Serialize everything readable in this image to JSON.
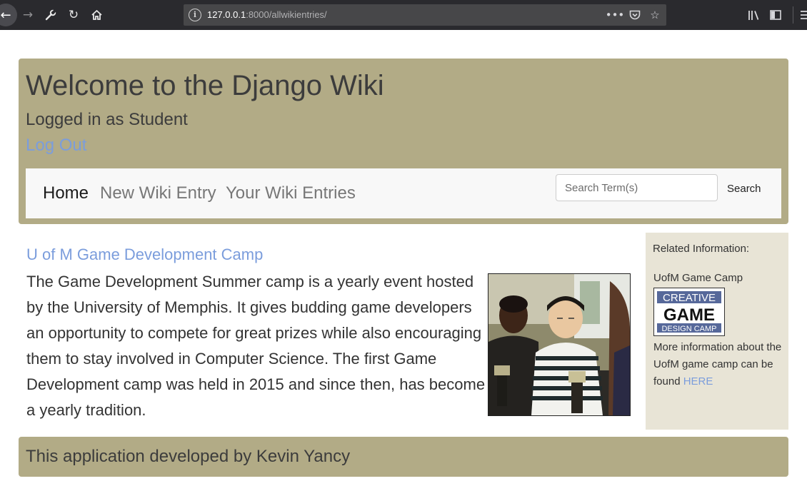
{
  "browser": {
    "url_host": "127.0.0.1",
    "url_rest": ":8000/allwikientries/",
    "icons": {
      "back": "back-arrow-icon",
      "forward": "forward-arrow-icon",
      "tools": "wrench-icon",
      "reload": "reload-icon",
      "home": "home-icon",
      "info": "info-icon",
      "page_actions": "more-dots-icon",
      "pocket": "pocket-icon",
      "bookmark": "star-icon",
      "library": "library-icon",
      "sidebar": "sidebar-icon",
      "menu": "hamburger-menu-icon"
    }
  },
  "header": {
    "title": "Welcome to the Django Wiki",
    "logged_in": "Logged in as Student",
    "logout_label": "Log Out"
  },
  "nav": {
    "items": [
      {
        "label": "Home",
        "active": true
      },
      {
        "label": "New Wiki Entry",
        "active": false
      },
      {
        "label": "Your Wiki Entries",
        "active": false
      }
    ],
    "search_placeholder": "Search Term(s)",
    "search_value": "",
    "search_button": "Search"
  },
  "entry": {
    "title": "U of M Game Development Camp",
    "body": "The Game Development Summer camp is a yearly event hosted by the University of Memphis. It gives budding game developers an opportunity to compete for great prizes while also encouraging them to stay involved in Computer Science. The first Game Development camp was held in 2015 and since then, has become a yearly tradition.",
    "image": "photo-students-with-trophies"
  },
  "sidebar": {
    "heading": "Related Information:",
    "camp_label": "UofM Game Camp",
    "logo": {
      "line1": "CREATIVE",
      "line2": "GAME",
      "line3": "DESIGN CAMP"
    },
    "more_text": "More information about the UofM game camp can be found ",
    "link_label": "HERE"
  },
  "footer": {
    "text": "This application developed by Kevin Yancy"
  },
  "colors": {
    "jumbotron": "#b2ab86",
    "sidebar": "#e8e4d6",
    "link": "#7b9ddc",
    "navbar": "#f8f8f8",
    "browser_toolbar": "#2a2a2e"
  }
}
